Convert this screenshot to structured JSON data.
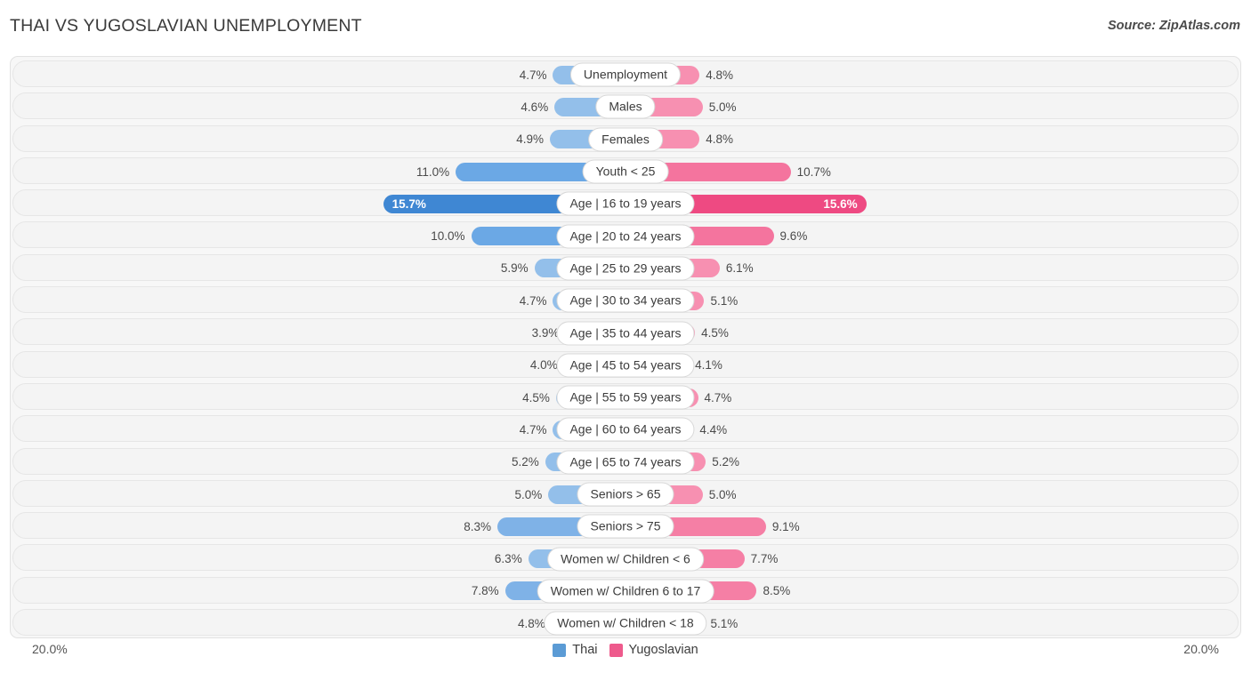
{
  "header": {
    "title": "THAI VS YUGOSLAVIAN UNEMPLOYMENT",
    "source": "Source: ZipAtlas.com"
  },
  "axis": {
    "left_max_label": "20.0%",
    "right_max_label": "20.0%"
  },
  "legend": {
    "items": [
      {
        "label": "Thai",
        "color": "#5b9bd5"
      },
      {
        "label": "Yugoslavian",
        "color": "#ee5a8c"
      }
    ]
  },
  "colors": {
    "thai_light": "#8cb9e8",
    "thai_mid": "#6ba8e5",
    "thai_strong": "#4a90d9",
    "yugo_light": "#f78bad",
    "yugo_mid": "#f4749e",
    "yugo_strong": "#ef4f86",
    "panel": "#f7f7f7"
  },
  "chart_data": {
    "type": "bar",
    "title": "THAI VS YUGOSLAVIAN UNEMPLOYMENT",
    "subtitle": "",
    "xlabel": "",
    "ylabel": "",
    "orientation": "horizontal-diverging",
    "axis_max_percent": 20.0,
    "grid": false,
    "legend_position": "bottom-center",
    "categories": [
      "Unemployment",
      "Males",
      "Females",
      "Youth < 25",
      "Age | 16 to 19 years",
      "Age | 20 to 24 years",
      "Age | 25 to 29 years",
      "Age | 30 to 34 years",
      "Age | 35 to 44 years",
      "Age | 45 to 54 years",
      "Age | 55 to 59 years",
      "Age | 60 to 64 years",
      "Age | 65 to 74 years",
      "Seniors > 65",
      "Seniors > 75",
      "Women w/ Children < 6",
      "Women w/ Children 6 to 17",
      "Women w/ Children < 18"
    ],
    "series": [
      {
        "name": "Thai",
        "color": "#5b9bd5",
        "values": [
          4.7,
          4.6,
          4.9,
          11.0,
          15.7,
          10.0,
          5.9,
          4.7,
          3.9,
          4.0,
          4.5,
          4.7,
          5.2,
          5.0,
          8.3,
          6.3,
          7.8,
          4.8
        ],
        "labels": [
          "4.7%",
          "4.6%",
          "4.9%",
          "11.0%",
          "15.7%",
          "10.0%",
          "5.9%",
          "4.7%",
          "3.9%",
          "4.0%",
          "4.5%",
          "4.7%",
          "5.2%",
          "5.0%",
          "8.3%",
          "6.3%",
          "7.8%",
          "4.8%"
        ]
      },
      {
        "name": "Yugoslavian",
        "color": "#ee5a8c",
        "values": [
          4.8,
          5.0,
          4.8,
          10.7,
          15.6,
          9.6,
          6.1,
          5.1,
          4.5,
          4.1,
          4.7,
          4.4,
          5.2,
          5.0,
          9.1,
          7.7,
          8.5,
          5.1
        ],
        "labels": [
          "4.8%",
          "5.0%",
          "4.8%",
          "10.7%",
          "15.6%",
          "9.6%",
          "6.1%",
          "5.1%",
          "4.5%",
          "4.1%",
          "4.7%",
          "4.4%",
          "5.2%",
          "5.0%",
          "9.1%",
          "7.7%",
          "8.5%",
          "5.1%"
        ]
      }
    ]
  }
}
